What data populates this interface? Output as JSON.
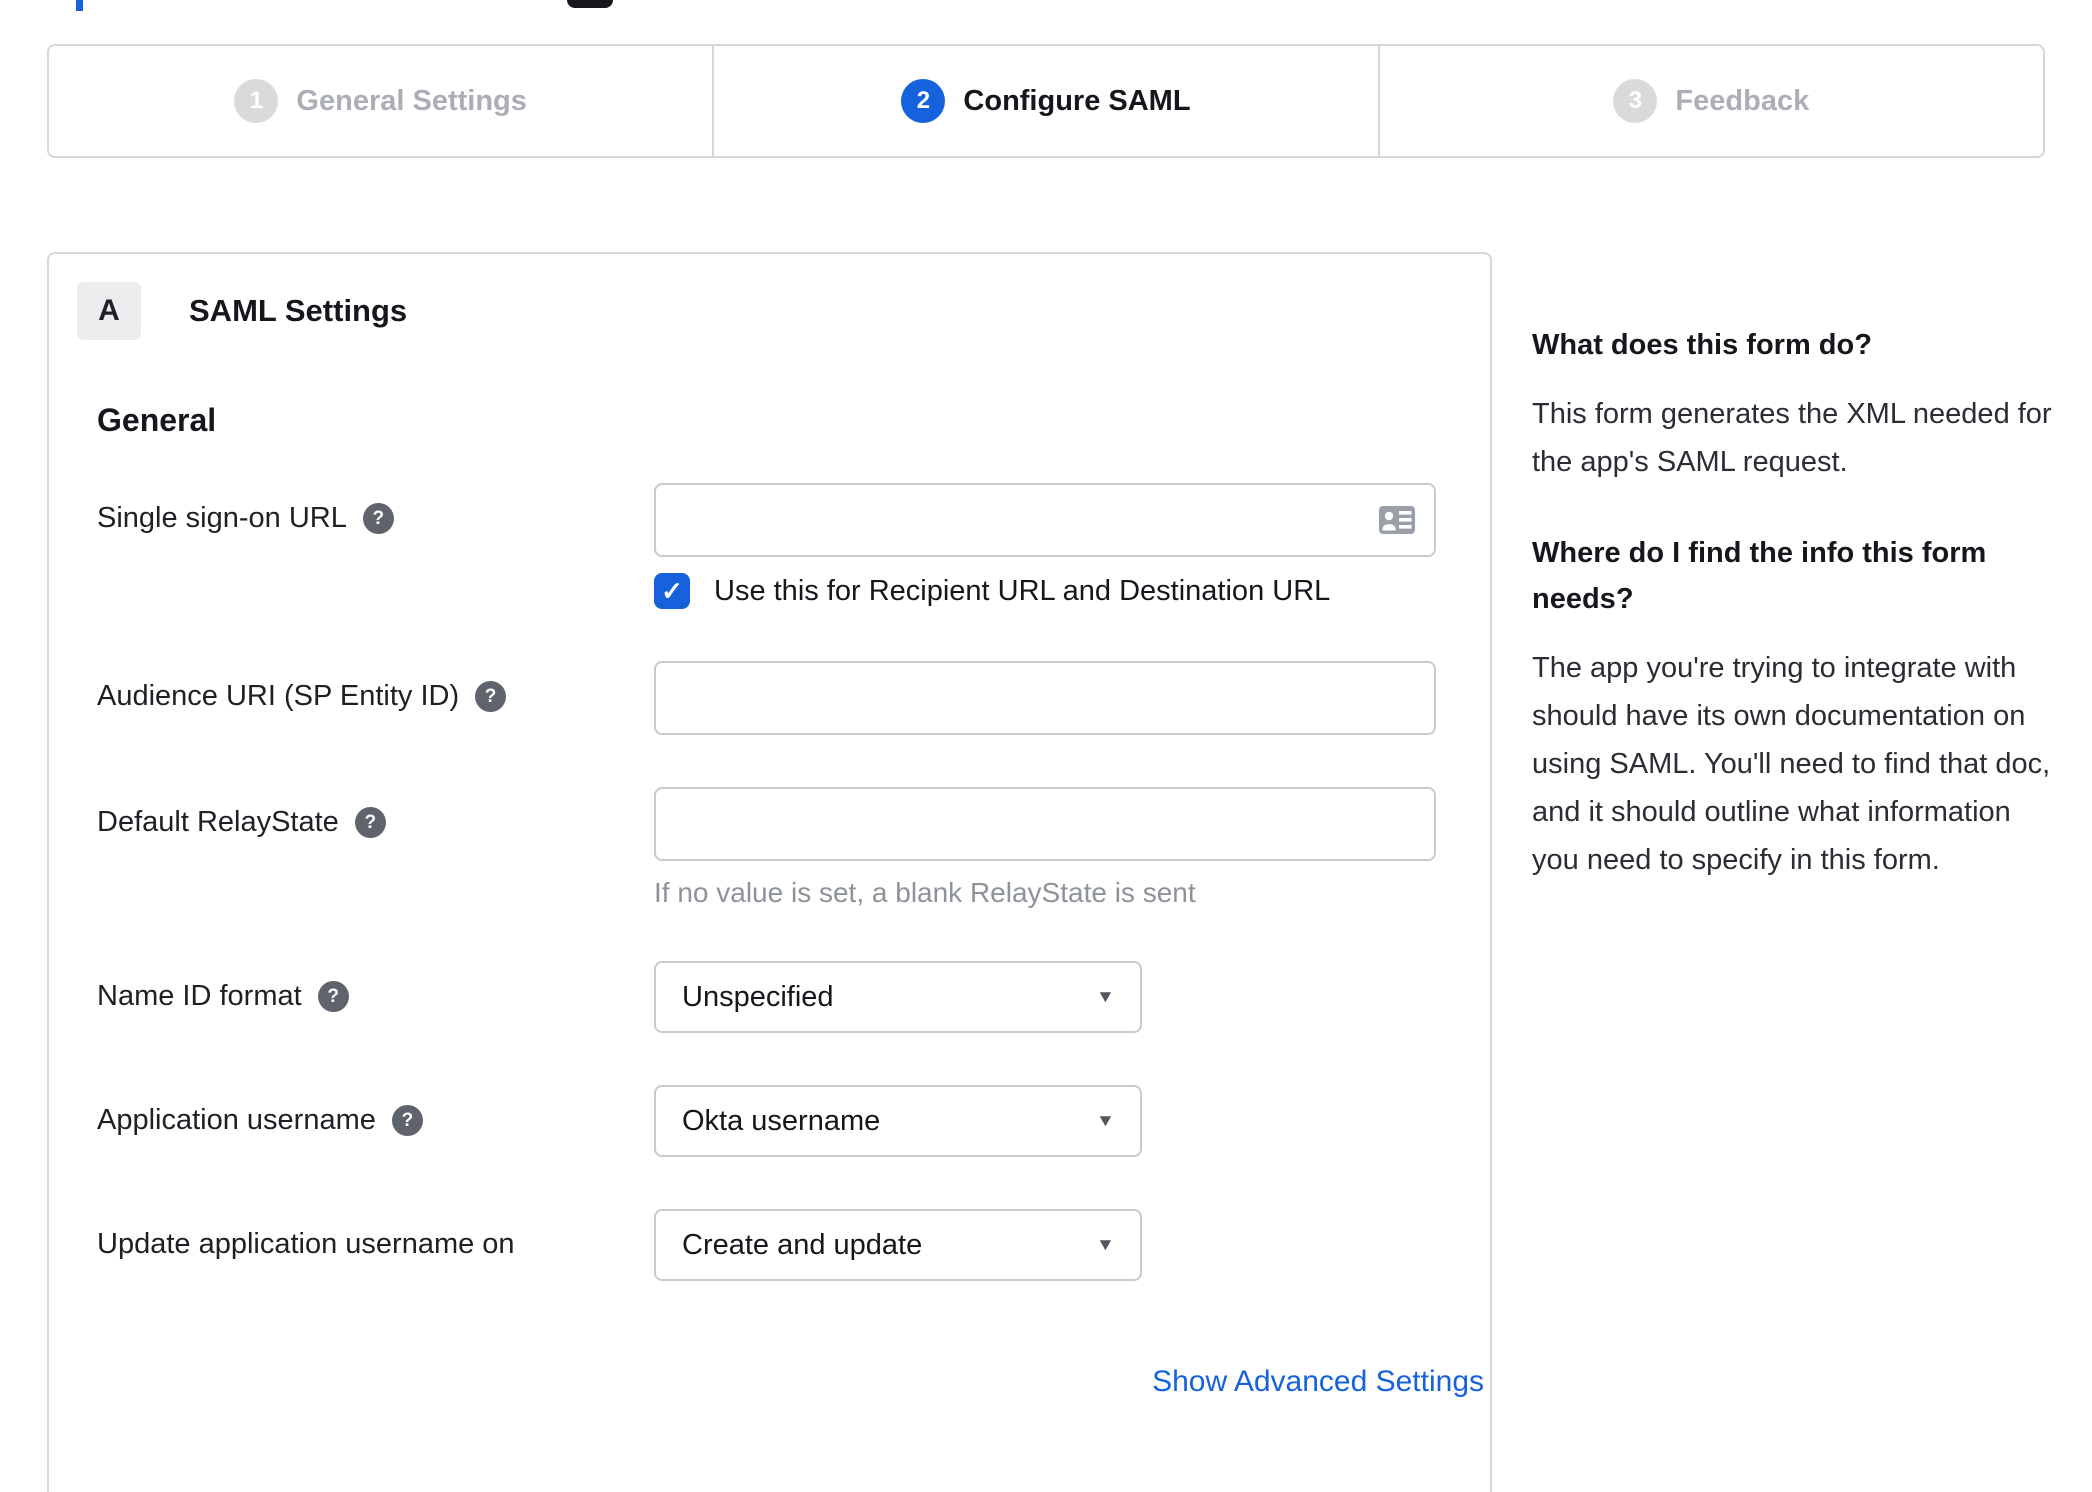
{
  "stepper": {
    "steps": [
      {
        "number": "1",
        "label": "General Settings",
        "state": "inactive"
      },
      {
        "number": "2",
        "label": "Configure SAML",
        "state": "active"
      },
      {
        "number": "3",
        "label": "Feedback",
        "state": "inactive"
      }
    ]
  },
  "panel": {
    "badge": "A",
    "title": "SAML Settings",
    "section_heading": "General"
  },
  "form": {
    "labels": {
      "sso": "Single sign-on URL",
      "audience": "Audience URI (SP Entity ID)",
      "relaystate": "Default RelayState",
      "nameid": "Name ID format",
      "appusername": "Application username",
      "updateusername": "Update application username on"
    },
    "inputs": {
      "sso_value": "",
      "audience_value": "",
      "relaystate_value": ""
    },
    "sso_checkbox_label": "Use this for Recipient URL and Destination URL",
    "sso_checkbox_checked": true,
    "relaystate_hint": "If no value is set, a blank RelayState is sent",
    "selects": {
      "name_id_format": "Unspecified",
      "application_username": "Okta username",
      "update_application_username_on": "Create and update"
    },
    "advanced_link": "Show Advanced Settings"
  },
  "sidebar": {
    "q1_title": "What does this form do?",
    "q1_body": "This form generates the XML needed for the app's SAML request.",
    "q2_title": "Where do I find the info this form needs?",
    "q2_body": "The app you're trying to integrate with should have its own documentation on using SAML. You'll need to find that doc, and it should outline what information you need to specify in this form."
  },
  "icons": {
    "help": "?",
    "check": "✓",
    "caret": "▼"
  },
  "colors": {
    "accent_blue": "#1662dd",
    "inactive_gray": "#d9dadc",
    "border_gray": "#d6d7d9",
    "text_dark": "#16171c",
    "hint_gray": "#8e9299"
  }
}
